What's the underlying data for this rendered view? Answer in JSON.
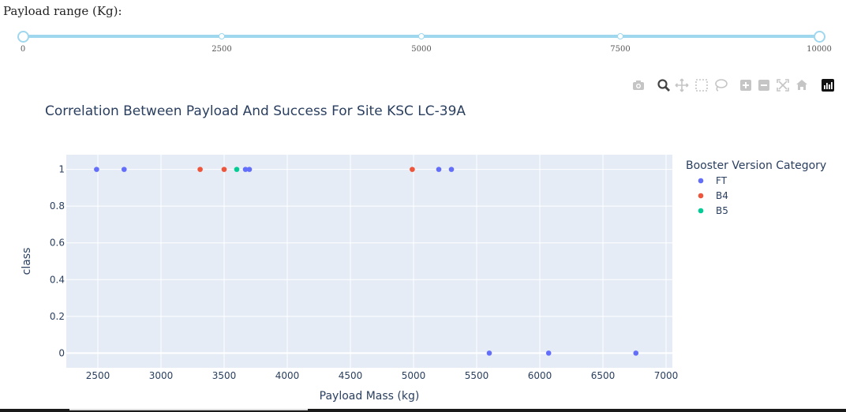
{
  "slider": {
    "label": "Payload range (Kg):",
    "min": 0,
    "max": 10000,
    "selected": [
      0,
      10000
    ],
    "marks": [
      "0",
      "2500",
      "5000",
      "7500",
      "10000"
    ]
  },
  "modebar": {
    "icons": [
      "camera-icon",
      "zoom-icon",
      "pan-icon",
      "box-select-icon",
      "lasso-select-icon",
      "zoom-in-icon",
      "zoom-out-icon",
      "autoscale-icon",
      "reset-axes-icon",
      "plotly-logo-icon"
    ]
  },
  "chart_data": {
    "type": "scatter",
    "title": "Correlation Between Payload And Success For Site KSC LC-39A",
    "xlabel": "Payload Mass (kg)",
    "ylabel": "class",
    "xlim": [
      2250,
      7050
    ],
    "ylim": [
      -0.08,
      1.08
    ],
    "xticks": [
      2500,
      3000,
      3500,
      4000,
      4500,
      5000,
      5500,
      6000,
      6500,
      7000
    ],
    "yticks": [
      0,
      0.2,
      0.4,
      0.6,
      0.8,
      1
    ],
    "grid": true,
    "legend": {
      "title": "Booster Version Category",
      "placement": "right"
    },
    "series": [
      {
        "name": "FT",
        "color": "#636efa",
        "points": [
          [
            2490,
            1
          ],
          [
            2708,
            1
          ],
          [
            3669,
            1
          ],
          [
            3700,
            1
          ],
          [
            5200,
            1
          ],
          [
            5300,
            1
          ],
          [
            5600,
            0
          ],
          [
            6070,
            0
          ],
          [
            6761,
            0
          ]
        ]
      },
      {
        "name": "B4",
        "color": "#ef553b",
        "points": [
          [
            3310,
            1
          ],
          [
            3500,
            1
          ],
          [
            4990,
            1
          ]
        ]
      },
      {
        "name": "B5",
        "color": "#00cc96",
        "points": [
          [
            3600,
            1
          ]
        ]
      }
    ]
  }
}
